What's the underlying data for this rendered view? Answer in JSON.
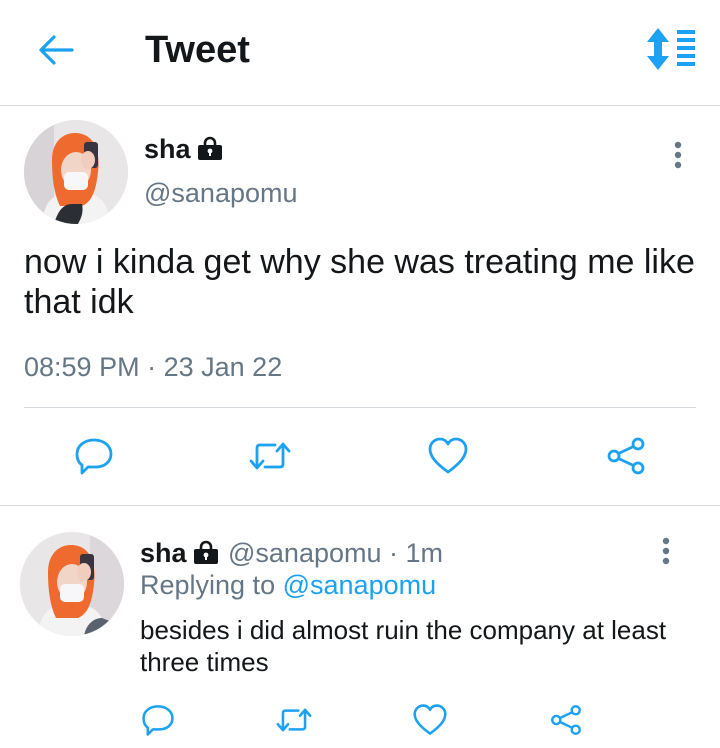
{
  "header": {
    "title": "Tweet",
    "accent_color": "#1da1f2"
  },
  "tweet": {
    "display_name": "sha",
    "handle": "@sanapomu",
    "text": "now i kinda get why she was treating me like that idk",
    "time": "08:59 PM",
    "separator": "·",
    "date": "23 Jan 22",
    "actions": [
      "reply-icon",
      "retweet-icon",
      "like-icon",
      "share-icon"
    ]
  },
  "reply": {
    "display_name": "sha",
    "handle": "@sanapomu",
    "separator": "·",
    "age": "1m",
    "replying_prefix": "Replying to",
    "replying_to": "@sanapomu",
    "text": "besides i did almost ruin the company at least three times",
    "actions": [
      "reply-icon",
      "retweet-icon",
      "like-icon",
      "share-icon"
    ]
  }
}
